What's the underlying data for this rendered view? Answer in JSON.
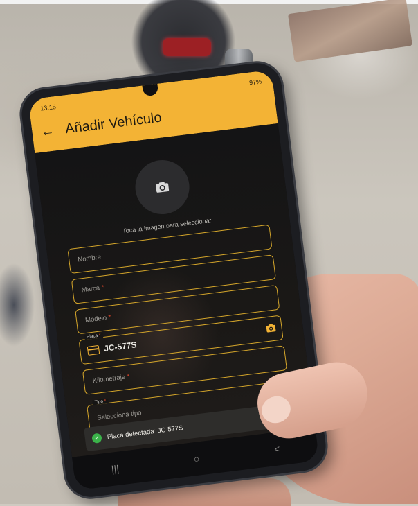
{
  "statusbar": {
    "time": "13:18",
    "battery": "97%"
  },
  "appbar": {
    "title": "Añadir Vehículo"
  },
  "image_picker": {
    "hint": "Toca la imagen para seleccionar"
  },
  "form": {
    "nombre": {
      "placeholder": "Nombre"
    },
    "marca": {
      "placeholder": "Marca",
      "required_mark": "*"
    },
    "modelo": {
      "placeholder": "Modelo",
      "required_mark": "*"
    },
    "placa": {
      "label": "Placa",
      "required_mark": "*",
      "value": "JC-577S"
    },
    "kilometraje": {
      "placeholder": "Kilometraje",
      "required_mark": "*"
    },
    "tipo": {
      "label": "Tipo",
      "required_mark": "*",
      "placeholder": "Selecciona tipo"
    }
  },
  "snackbar": {
    "message": "Placa detectada: JC-577S"
  },
  "navbar": {
    "recent": "|||",
    "home": "○",
    "back": "<"
  },
  "colors": {
    "accent": "#f3b335",
    "border": "#d6a72b",
    "success": "#3bb34a"
  }
}
